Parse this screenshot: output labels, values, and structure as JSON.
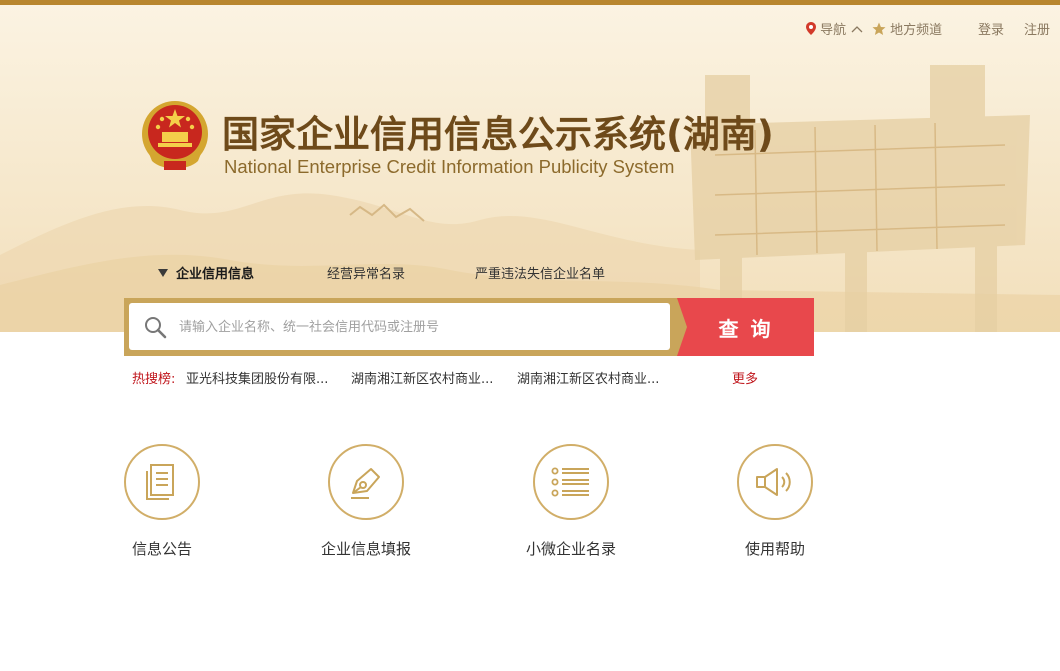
{
  "header": {
    "nav_label": "导航",
    "nav_caret": "^",
    "region_label": "地方频道",
    "login_label": "登录",
    "register_label": "注册"
  },
  "site": {
    "title_cn": "国家企业信用信息公示系统(湖南)",
    "title_en": "National Enterprise Credit Information Publicity System"
  },
  "tabs": [
    {
      "label": "企业信用信息",
      "active": true
    },
    {
      "label": "经营异常名录",
      "active": false
    },
    {
      "label": "严重违法失信企业名单",
      "active": false
    }
  ],
  "search": {
    "placeholder": "请输入企业名称、统一社会信用代码或注册号",
    "value": "",
    "button_label": "查询"
  },
  "hot": {
    "label": "热搜榜:",
    "items": [
      "亚光科技集团股份有限...",
      "湖南湘江新区农村商业...",
      "湖南湘江新区农村商业..."
    ],
    "more_label": "更多"
  },
  "features": [
    {
      "label": "信息公告",
      "icon": "document-icon"
    },
    {
      "label": "企业信息填报",
      "icon": "pen-nib-icon"
    },
    {
      "label": "小微企业名录",
      "icon": "list-icon"
    },
    {
      "label": "使用帮助",
      "icon": "megaphone-icon"
    }
  ],
  "colors": {
    "accent_gold": "#c9a55a",
    "title_brown": "#6e4a1a",
    "search_button": "#e8484c",
    "hot_label_red": "#c0161c",
    "top_bar": "#b8862e"
  }
}
